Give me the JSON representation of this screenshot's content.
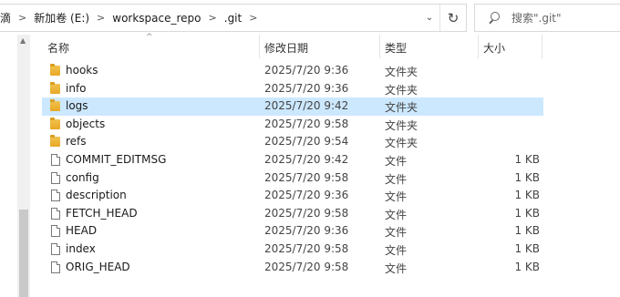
{
  "address_bar": {
    "breadcrumbs": [
      "滴",
      "新加卷 (E:)",
      "workspace_repo",
      ".git"
    ],
    "dropdown_icon": "chevron-down-icon",
    "refresh_icon": "refresh-icon"
  },
  "search": {
    "placeholder": "搜索\".git\""
  },
  "columns": {
    "name": "名称",
    "date": "修改日期",
    "type": "类型",
    "size": "大小"
  },
  "files": [
    {
      "name": "hooks",
      "date": "2025/7/20 9:36",
      "type": "文件夹",
      "size": "",
      "kind": "folder"
    },
    {
      "name": "info",
      "date": "2025/7/20 9:36",
      "type": "文件夹",
      "size": "",
      "kind": "folder"
    },
    {
      "name": "logs",
      "date": "2025/7/20 9:42",
      "type": "文件夹",
      "size": "",
      "kind": "folder",
      "selected": true
    },
    {
      "name": "objects",
      "date": "2025/7/20 9:58",
      "type": "文件夹",
      "size": "",
      "kind": "folder"
    },
    {
      "name": "refs",
      "date": "2025/7/20 9:54",
      "type": "文件夹",
      "size": "",
      "kind": "folder"
    },
    {
      "name": "COMMIT_EDITMSG",
      "date": "2025/7/20 9:42",
      "type": "文件",
      "size": "1 KB",
      "kind": "file"
    },
    {
      "name": "config",
      "date": "2025/7/20 9:58",
      "type": "文件",
      "size": "1 KB",
      "kind": "file"
    },
    {
      "name": "description",
      "date": "2025/7/20 9:36",
      "type": "文件",
      "size": "1 KB",
      "kind": "file"
    },
    {
      "name": "FETCH_HEAD",
      "date": "2025/7/20 9:58",
      "type": "文件",
      "size": "1 KB",
      "kind": "file"
    },
    {
      "name": "HEAD",
      "date": "2025/7/20 9:36",
      "type": "文件",
      "size": "1 KB",
      "kind": "file"
    },
    {
      "name": "index",
      "date": "2025/7/20 9:58",
      "type": "文件",
      "size": "1 KB",
      "kind": "file"
    },
    {
      "name": "ORIG_HEAD",
      "date": "2025/7/20 9:58",
      "type": "文件",
      "size": "1 KB",
      "kind": "file"
    }
  ],
  "colors": {
    "selection": "#cce8ff",
    "folder": "#e8a825"
  }
}
